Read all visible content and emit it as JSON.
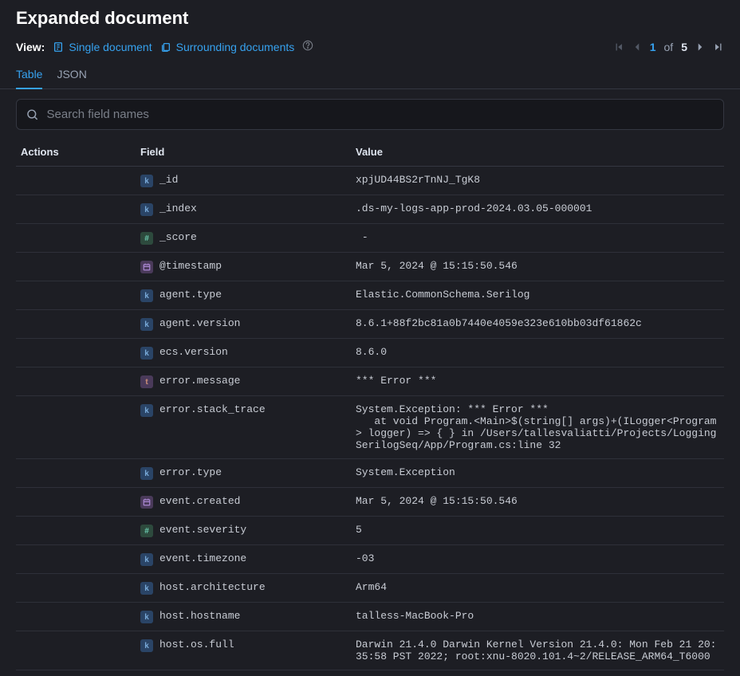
{
  "title": "Expanded document",
  "view": {
    "label": "View:",
    "single": "Single document",
    "surrounding": "Surrounding documents"
  },
  "pager": {
    "current": "1",
    "of": "of",
    "total": "5"
  },
  "tabs": {
    "table": "Table",
    "json": "JSON"
  },
  "search": {
    "placeholder": "Search field names"
  },
  "columns": {
    "actions": "Actions",
    "field": "Field",
    "value": "Value"
  },
  "rows": [
    {
      "type": "k",
      "field": "_id",
      "value": "xpjUD44BS2rTnNJ_TgK8"
    },
    {
      "type": "k",
      "field": "_index",
      "value": ".ds-my-logs-app-prod-2024.03.05-000001"
    },
    {
      "type": "hash",
      "field": "_score",
      "value": " - "
    },
    {
      "type": "date",
      "field": "@timestamp",
      "value": "Mar 5, 2024 @ 15:15:50.546"
    },
    {
      "type": "k",
      "field": "agent.type",
      "value": "Elastic.CommonSchema.Serilog"
    },
    {
      "type": "k",
      "field": "agent.version",
      "value": "8.6.1+88f2bc81a0b7440e4059e323e610bb03df61862c"
    },
    {
      "type": "k",
      "field": "ecs.version",
      "value": "8.6.0"
    },
    {
      "type": "t",
      "field": "error.message",
      "value": "*** Error ***"
    },
    {
      "type": "k",
      "field": "error.stack_trace",
      "value": "System.Exception: *** Error ***\n   at void Program.<Main>$(string[] args)+(ILogger<Program> logger) => { } in /Users/tallesvaliatti/Projects/LoggingSerilogSeq/App/Program.cs:line 32"
    },
    {
      "type": "k",
      "field": "error.type",
      "value": "System.Exception"
    },
    {
      "type": "date",
      "field": "event.created",
      "value": "Mar 5, 2024 @ 15:15:50.546"
    },
    {
      "type": "hash",
      "field": "event.severity",
      "value": "5"
    },
    {
      "type": "k",
      "field": "event.timezone",
      "value": "-03"
    },
    {
      "type": "k",
      "field": "host.architecture",
      "value": "Arm64"
    },
    {
      "type": "k",
      "field": "host.hostname",
      "value": "talless-MacBook-Pro"
    },
    {
      "type": "k",
      "field": "host.os.full",
      "value": "Darwin 21.4.0 Darwin Kernel Version 21.4.0: Mon Feb 21 20:35:58 PST 2022; root:xnu-8020.101.4~2/RELEASE_ARM64_T6000"
    }
  ]
}
